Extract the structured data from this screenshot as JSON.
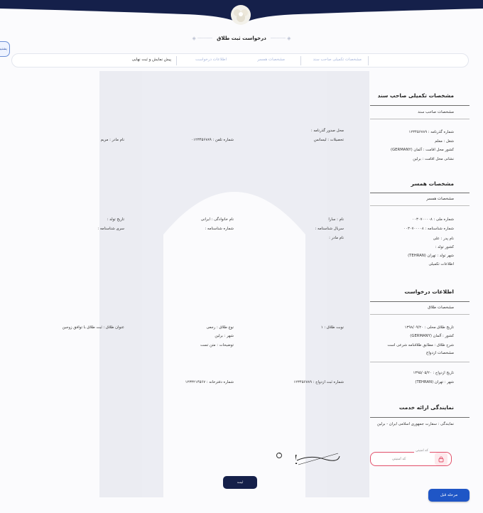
{
  "page": {
    "title": "درخواست ثبت طلاق"
  },
  "side_tab": {
    "label": "پشتیبانی"
  },
  "steps": [
    {
      "label": "مشخصات تکمیلی صاحب سند",
      "state": "done"
    },
    {
      "label": "مشخصات همسر",
      "state": "done"
    },
    {
      "label": "اطلاعات درخواست",
      "state": "done"
    },
    {
      "label": "پیش نمایش و ثبت نهایی",
      "state": "active"
    }
  ],
  "owner": {
    "section_title": "مشخصات تکمیلی صاحب سند",
    "sub_title": "مشخصات صاحب سند",
    "passport_no": "شماره گذرنامه : ۱۲۳۴۵۶۷۸۹",
    "issue_place": "محل صدور گذرنامه :",
    "job": "شغل : معلم",
    "education": "تحصیلات : لیسانس",
    "phone": "شماره تلفن : ۰۱۲۳۴۵۶۷۸۹",
    "mother_name": "نام مادر : مریم",
    "residence_country": "کشور محل اقامت : آلمان (GERMANY)",
    "residence_address": "نشانی محل اقامت : برلین"
  },
  "spouse": {
    "section_title": "مشخصات همسر",
    "sub_title": "مشخصات همسر",
    "national_id": "شماره ملی : ۰۰۳۰۷۰۰۰۰۸",
    "first_name": "نام : سارا",
    "last_name": "نام خانوادگی : ایرانی",
    "birth_date": "تاریخ تولد :",
    "id_no": "شماره شناسنامه : ۰۰۳۰۷۰۰۰۰۸",
    "serial": "سریال شناسنامه :",
    "id_no2": "شماره شناسنامه :",
    "id_series": "سری شناسنامه :",
    "father_name": "نام پدر : علی",
    "mother_name": "نام مادر :",
    "birth_country": "کشور تولد :",
    "birth_city": "شهر تولد : تهران (TEHRAN)",
    "extra_info": "اطلاعات تکمیلی"
  },
  "request": {
    "section_title": "اطلاعات درخواست",
    "divorce_sub": "مشخصات طلاق",
    "divorce_date": "تاریخ طلاق محلی : ۱۳۹۸/۰۹/۲۰",
    "divorce_turn": "نوبت طلاق : ۱",
    "divorce_type": "نوع طلاق : رجعی",
    "divorce_title": "عنوان طلاق : ثبت طلاق با توافق زوجین",
    "country": "کشور : آلمان (GERMANY)",
    "city": "شهر : برلین",
    "description": "شرح طلاق : مطابق طلاقنامه شرعی است",
    "notes": "توضیحات : متن تست",
    "marriage_sub": "مشخصات ازدواج",
    "marriage_date": "تاریخ ازدواج : ۱۳۹۵/۰۵/۲۰",
    "marriage_city": "شهر : تهران (TEHRAN)",
    "marriage_reg_no": "شماره ثبت ازدواج : ۱۲۳۴۵۶۷۸۹",
    "office_no": "شماره دفترخانه : ۱۲۳۳۲۱۴۵۶۷"
  },
  "service": {
    "section_title": "نمایندگی ارائه خدمت",
    "agency": "نمایندگی : سفارت جمهوری اسلامی ایران - برلین"
  },
  "captcha": {
    "image_text": "8981",
    "label": "کد امنیتی",
    "placeholder": "کد امنیتی"
  },
  "buttons": {
    "submit": "ثبت",
    "previous": "مرحله قبل"
  },
  "colors": {
    "banner": "#15204a",
    "primary": "#1f56c6",
    "error": "#e2506a"
  }
}
